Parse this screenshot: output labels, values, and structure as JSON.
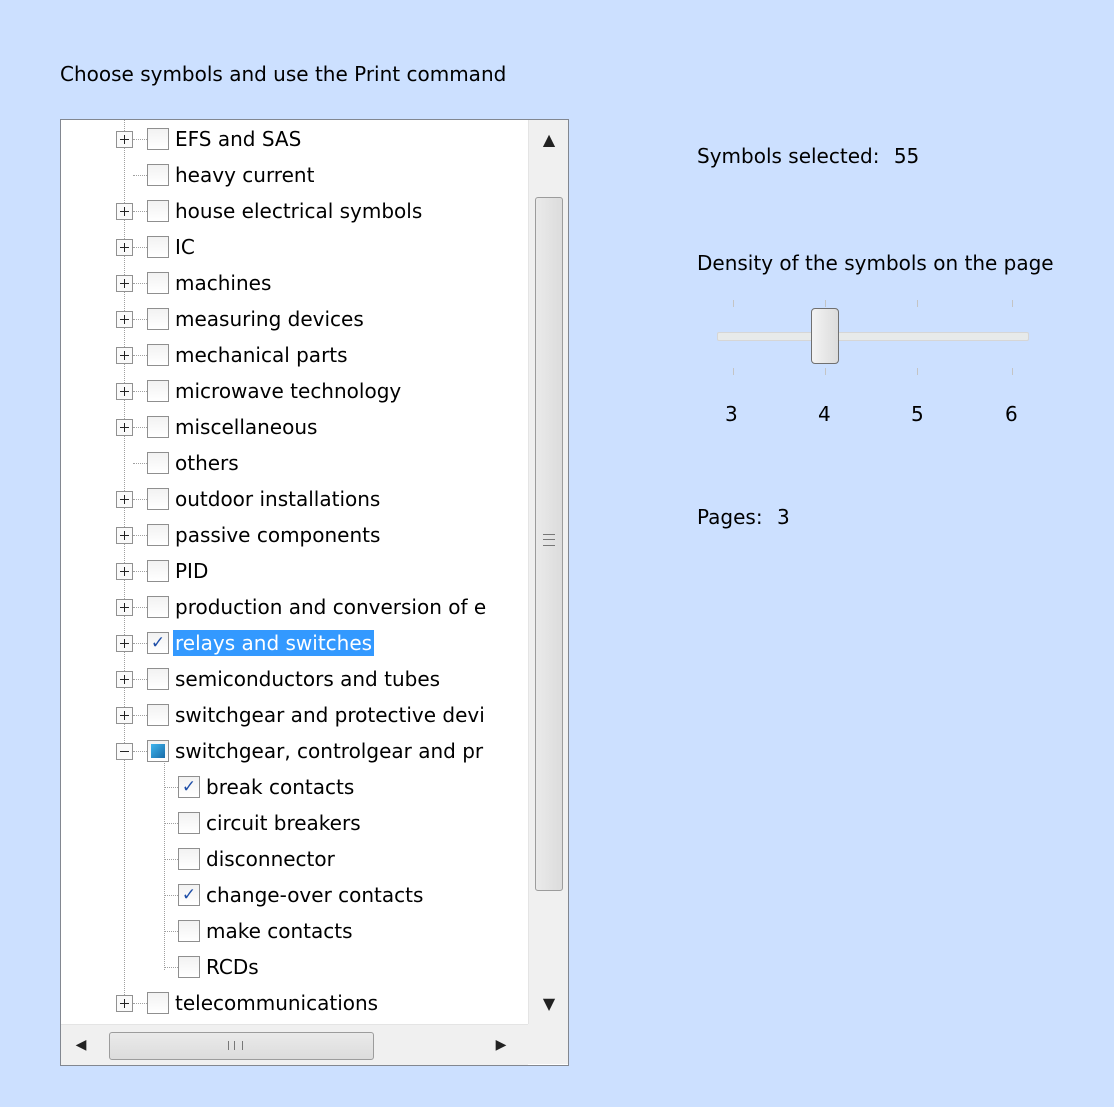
{
  "instruction": "Choose symbols and use the Print command",
  "tree": {
    "items": [
      {
        "label": "EFS and SAS",
        "expander": "plus",
        "checked": false
      },
      {
        "label": "heavy current",
        "expander": "none",
        "checked": false
      },
      {
        "label": "house electrical symbols",
        "expander": "plus",
        "checked": false
      },
      {
        "label": "IC",
        "expander": "plus",
        "checked": false
      },
      {
        "label": "machines",
        "expander": "plus",
        "checked": false
      },
      {
        "label": "measuring devices",
        "expander": "plus",
        "checked": false
      },
      {
        "label": "mechanical parts",
        "expander": "plus",
        "checked": false
      },
      {
        "label": "microwave technology",
        "expander": "plus",
        "checked": false
      },
      {
        "label": "miscellaneous",
        "expander": "plus",
        "checked": false
      },
      {
        "label": "others",
        "expander": "none",
        "checked": false
      },
      {
        "label": "outdoor installations",
        "expander": "plus",
        "checked": false
      },
      {
        "label": "passive components",
        "expander": "plus",
        "checked": false
      },
      {
        "label": "PID",
        "expander": "plus",
        "checked": false
      },
      {
        "label": "production and conversion of e",
        "expander": "plus",
        "checked": false
      },
      {
        "label": "relays and switches",
        "expander": "plus",
        "checked": true,
        "selected": true
      },
      {
        "label": "semiconductors and tubes",
        "expander": "plus",
        "checked": false
      },
      {
        "label": "switchgear and protective devi",
        "expander": "plus",
        "checked": false
      },
      {
        "label": "switchgear, controlgear and pr",
        "expander": "minus",
        "checked": "partial"
      },
      {
        "label": "break contacts",
        "level": 2,
        "checked": true
      },
      {
        "label": "circuit breakers",
        "level": 2,
        "checked": false
      },
      {
        "label": "disconnector",
        "level": 2,
        "checked": false
      },
      {
        "label": "change-over contacts",
        "level": 2,
        "checked": true
      },
      {
        "label": "make contacts",
        "level": 2,
        "checked": false
      },
      {
        "label": "RCDs",
        "level": 2,
        "checked": false
      },
      {
        "label": "telecommunications",
        "expander": "plus",
        "checked": false
      }
    ],
    "scroll_grip_label": "III",
    "check_glyph": "✓"
  },
  "symbols_selected": {
    "label": "Symbols selected:",
    "value": "55"
  },
  "density": {
    "label": "Density of the symbols on the page",
    "ticks": [
      "3",
      "4",
      "5",
      "6"
    ],
    "value": 4
  },
  "pages": {
    "label": "Pages:",
    "value": "3"
  },
  "colors": {
    "background": "#cce0ff",
    "selection": "#3399ff"
  }
}
